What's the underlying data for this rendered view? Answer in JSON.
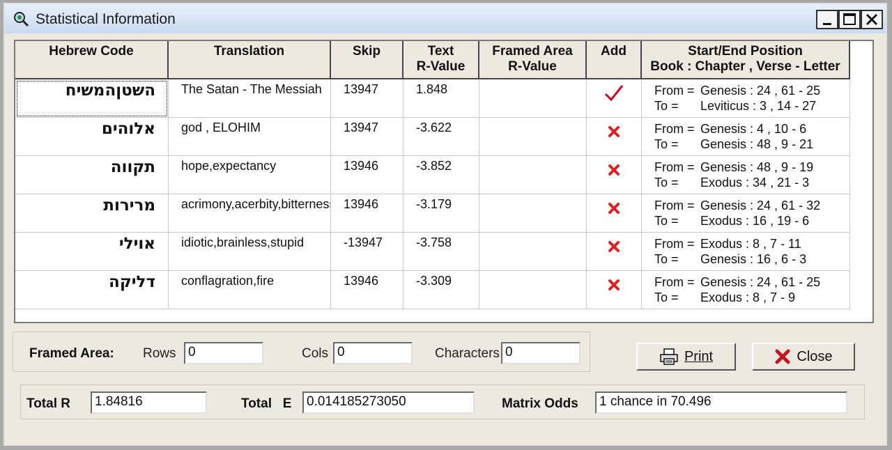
{
  "window": {
    "title": "Statistical Information"
  },
  "columns": {
    "hebrew": "Hebrew Code",
    "translation": "Translation",
    "skip": "Skip",
    "text_r_1": "Text",
    "text_r_2": "R-Value",
    "framed_r_1": "Framed Area",
    "framed_r_2": "R-Value",
    "add": "Add",
    "pos_1": "Start/End Position",
    "pos_2": "Book : Chapter , Verse - Letter"
  },
  "from_label": "From =",
  "to_label": "To =",
  "rows": [
    {
      "hebrew": "השטןהמשיח",
      "translation": "The Satan - The Messiah",
      "skip": "13947",
      "text_r": "1.848",
      "framed_r": "",
      "added": true,
      "from": "Genesis : 24 , 61 - 25",
      "to": "Leviticus : 3 , 14 - 27"
    },
    {
      "hebrew": "אלוהים",
      "translation": "god , ELOHIM",
      "skip": "13947",
      "text_r": "-3.622",
      "framed_r": "",
      "added": false,
      "from": "Genesis : 4 , 10 - 6",
      "to": "Genesis : 48 , 9 - 21"
    },
    {
      "hebrew": "תקווה",
      "translation": "hope,expectancy",
      "skip": "13946",
      "text_r": "-3.852",
      "framed_r": "",
      "added": false,
      "from": "Genesis : 48 , 9 - 19",
      "to": "Exodus : 34 , 21 - 3"
    },
    {
      "hebrew": "מרירות",
      "translation": "acrimony,acerbity,bitterness",
      "skip": "13946",
      "text_r": "-3.179",
      "framed_r": "",
      "added": false,
      "from": "Genesis : 24 , 61 - 32",
      "to": "Exodus : 16 , 19 - 6"
    },
    {
      "hebrew": "אוילי",
      "translation": "idiotic,brainless,stupid",
      "skip": "-13947",
      "text_r": "-3.758",
      "framed_r": "",
      "added": false,
      "from": "Exodus : 8 , 7 - 11",
      "to": "Genesis : 16 , 6 - 3"
    },
    {
      "hebrew": "דליקה",
      "translation": "conflagration,fire",
      "skip": "13946",
      "text_r": "-3.309",
      "framed_r": "",
      "added": false,
      "from": "Genesis : 24 , 61 - 25",
      "to": "Exodus : 8 , 7 - 9"
    }
  ],
  "framed_area": {
    "label": "Framed Area:",
    "rows_label": "Rows",
    "rows_value": "0",
    "cols_label": "Cols",
    "cols_value": "0",
    "chars_label": "Characters",
    "chars_value": "0"
  },
  "buttons": {
    "print": "Print",
    "close": "Close"
  },
  "totals": {
    "total_r_label": "Total R",
    "total_r_value": "1.84816",
    "total_e_label": "Total   E",
    "total_e_value": "0.014185273050",
    "odds_label": "Matrix Odds",
    "odds_value": "1 chance in 70.496"
  },
  "colors": {
    "check": "#d0021b",
    "cross": "#e02020",
    "title_bg": "#c9daf0"
  }
}
